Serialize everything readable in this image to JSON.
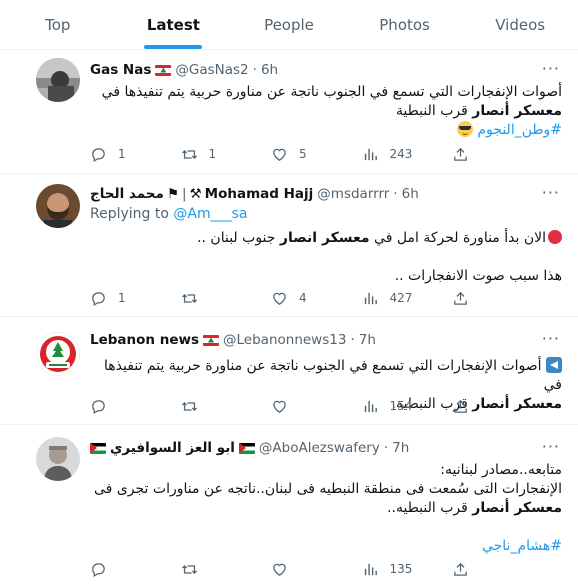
{
  "tabs": [
    {
      "label": "Top",
      "active": false
    },
    {
      "label": "Latest",
      "active": true
    },
    {
      "label": "People",
      "active": false
    },
    {
      "label": "Photos",
      "active": false
    },
    {
      "label": "Videos",
      "active": false
    }
  ],
  "colors": {
    "accent": "#1d9bf0",
    "text": "#0f1419",
    "secondary": "#536471",
    "border": "#eff3f4"
  },
  "tweets": [
    {
      "name": "Gas Nas",
      "handle": "@GasNas2",
      "time": "6h",
      "line1": "أصوات الإنفجارات التي تسمع في الجنوب ناتجة عن مناورة حربية يتم تنفيذها في",
      "line2_bold": "معسكر أنصار",
      "line2_rest": " قرب النبطية",
      "hashtag": "#وطن_النجوم",
      "replies": "1",
      "retweets": "1",
      "likes": "5",
      "views": "243"
    },
    {
      "name": "Mohamad Hajj",
      "name_prefix": "محمد الحاج",
      "handle": "@msdarrrr",
      "time": "6h",
      "replying_label": "Replying to",
      "replying_to": "@Am___sa",
      "line1_pre": "الان بدأ مناورة لحركة امل في ",
      "line1_bold": "معسكر انصار",
      "line1_post": " جنوب لبنان ..",
      "line2": "هذا سبب صوت الانفجارات ..",
      "replies": "1",
      "retweets": "",
      "likes": "4",
      "views": "427"
    },
    {
      "name": "Lebanon news",
      "handle": "@Lebanonnews13",
      "time": "7h",
      "line1": "أصوات الإنفجارات التي تسمع في الجنوب ناتجة عن مناورة حربية يتم تنفيذها في",
      "line2_bold": "معسكر أنصار",
      "line2_rest": " قرب النبطية.",
      "replies": "",
      "retweets": "",
      "likes": "",
      "views": "154"
    },
    {
      "name": "ابو العز السوافيري",
      "handle": "@AboAlezswafery",
      "time": "7h",
      "line1": "متابعه..مصادر لبنانيه:",
      "line2": "الإنفجارات التى سُمعت فى منطقة النبطيه فى لبنان..ناتجه عن مناورات تجرى فى",
      "line3_bold": "معسكر أنصار",
      "line3_rest": " قرب النبطيه..",
      "hashtag": "#هشام_ناجي",
      "replies": "",
      "retweets": "",
      "likes": "",
      "views": "135"
    }
  ]
}
